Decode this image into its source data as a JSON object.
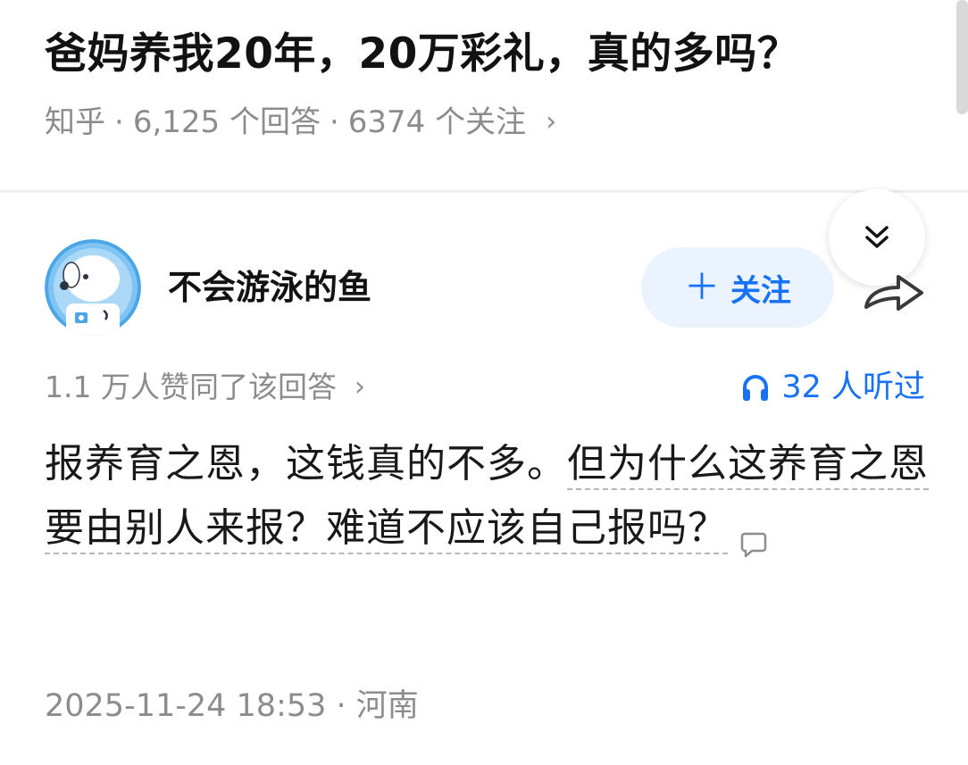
{
  "question": {
    "title": "爸妈养我20年，20万彩礼，真的多吗？",
    "source": "知乎",
    "answers_count": "6,125 个回答",
    "followers_count": "6374 个关注",
    "separator": "·",
    "chevron": "›"
  },
  "author": {
    "name": "不会游泳的鱼",
    "avatar_icon": "astronaut-dog-avatar",
    "follow_label": "＋ 关注",
    "follow_plus": "＋",
    "follow_text": "关注"
  },
  "answer": {
    "upvote_summary": "1.1 万人赞同了该回答",
    "upvote_chevron": "›",
    "listen_count": "32 人听过",
    "text_plain": "报养育之恩，这钱真的不多。",
    "text_annotated": "但为什么这养育之恩要由别人来报？难道不应该自己报吗？",
    "text_annotated_line1": "但为什么这养",
    "text_annotated_line2": "育之恩要由别人来报？难道不应该自己报吗",
    "text_annotated_line3": "？",
    "time_and_location": "2025-11-24 18:53 · 河南"
  },
  "colors": {
    "accent": "#1772f6",
    "follow_bg": "#ebf3ff",
    "meta_gray": "#8c8c8c",
    "text": "#121212"
  },
  "icons": {
    "collapse": "double-chevron-down-icon",
    "share": "share-arrow-icon",
    "headphones": "headphones-icon",
    "comment": "comment-bubble-icon"
  }
}
